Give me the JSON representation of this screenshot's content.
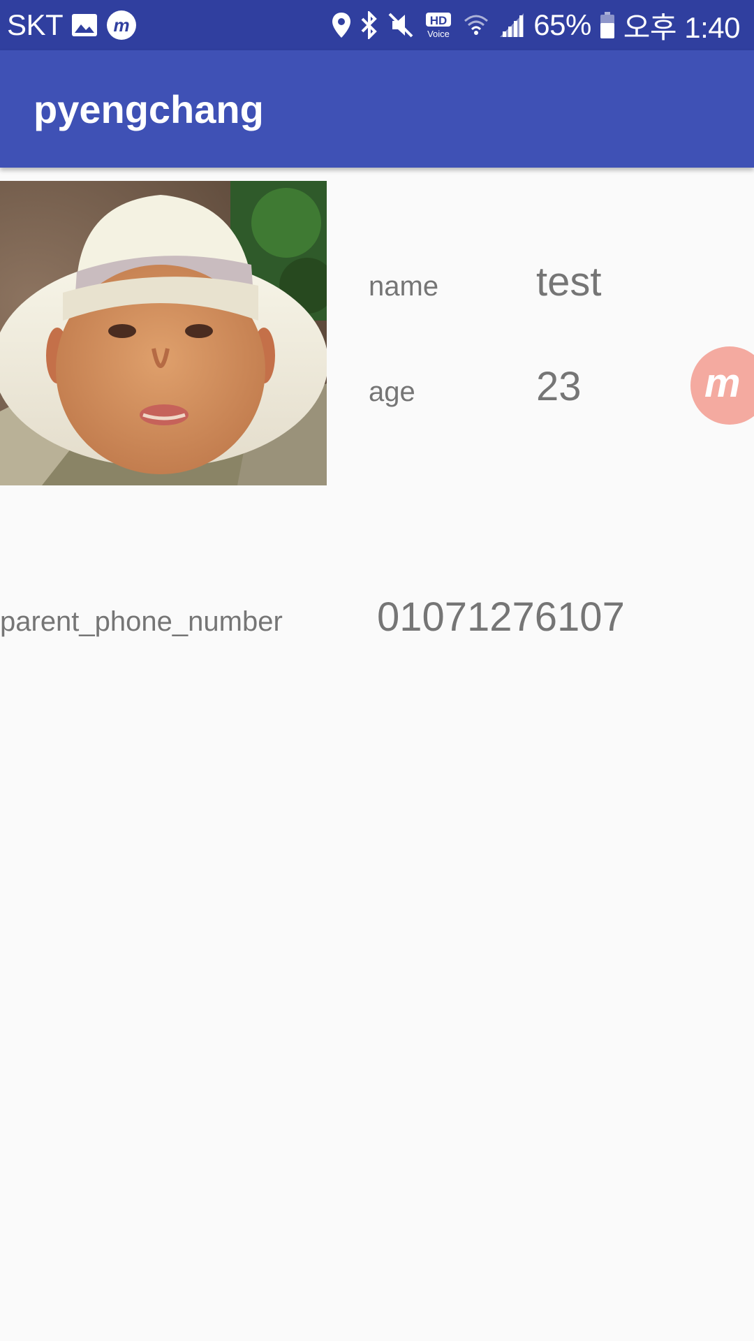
{
  "status_bar": {
    "carrier": "SKT",
    "battery": "65%",
    "time": "오후 1:40",
    "hd_badge": "HD",
    "hd_sub": "Voice",
    "icons": [
      "image-icon",
      "m-app-icon",
      "location-icon",
      "bluetooth-icon",
      "mute-icon",
      "hd-voice-icon",
      "wifi-icon",
      "signal-icon",
      "battery-icon"
    ]
  },
  "app_bar": {
    "title": "pyengchang"
  },
  "profile": {
    "name_label": "name",
    "name_value": "test",
    "age_label": "age",
    "age_value": "23",
    "phone_label": "parent_phone_number",
    "phone_value": "01071276107"
  },
  "colors": {
    "status_bar": "#303f9f",
    "app_bar": "#3f51b5",
    "background": "#fafafa",
    "text_secondary": "#757575",
    "bubble": "#f4aaa0"
  }
}
